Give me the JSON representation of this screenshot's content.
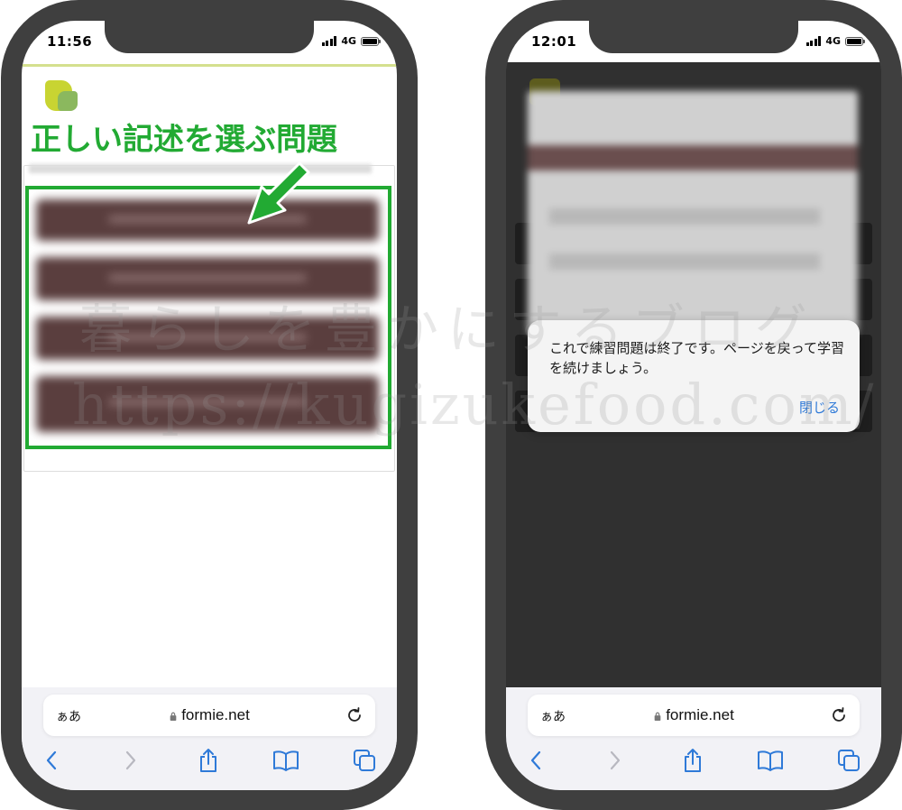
{
  "left_phone": {
    "status_time": "11:56",
    "network": "4G",
    "callout": "正しい記述を選ぶ問題",
    "url_bar": {
      "text_size_label": "ぁあ",
      "url": "formie.net"
    }
  },
  "right_phone": {
    "status_time": "12:01",
    "network": "4G",
    "dialog": {
      "message": "これで練習問題は終了です。ページを戻って学習を続けましょう。",
      "close_label": "閉じる"
    },
    "url_bar": {
      "text_size_label": "ぁあ",
      "url": "formie.net"
    }
  },
  "watermark": {
    "line1": "暮らしを豊かにするブログ",
    "line2": "https://kugizukefood.com/"
  },
  "colors": {
    "phone_frame": "#3f3f3f",
    "highlight_green": "#22aa33",
    "link_blue": "#2f7ad8"
  }
}
